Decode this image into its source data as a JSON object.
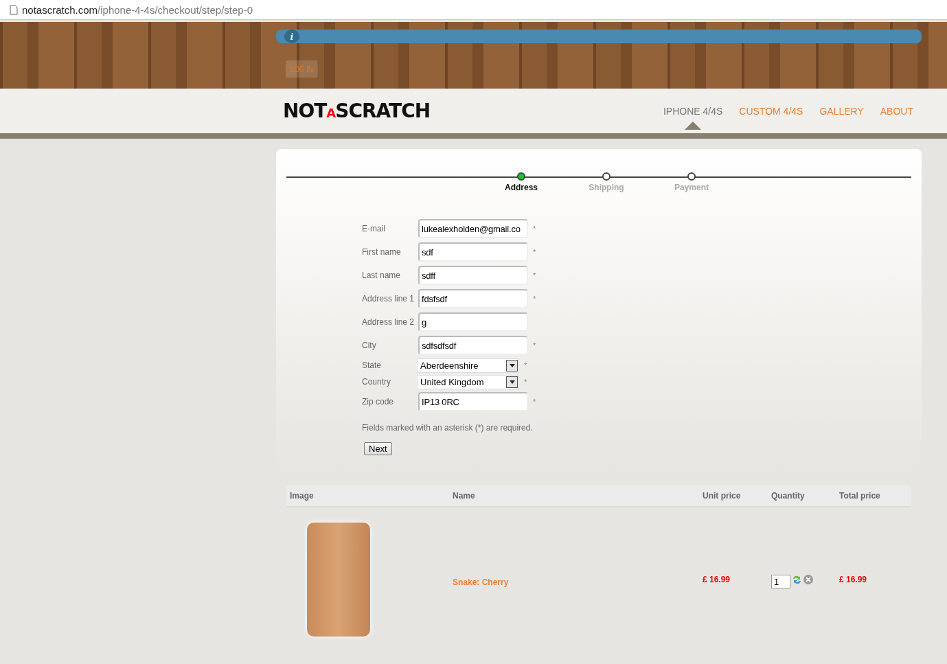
{
  "address_bar": {
    "host": "notascratch.com",
    "path": "/iphone-4-4s/checkout/step/step-0"
  },
  "header": {
    "login": "LOG IN",
    "info_icon": "i"
  },
  "logo": {
    "before": "NOT",
    "accent": "A",
    "after": "SCRATCH"
  },
  "nav": [
    {
      "label": "IPHONE 4/4S",
      "selected": true
    },
    {
      "label": "CUSTOM 4/4S",
      "selected": false
    },
    {
      "label": "GALLERY",
      "selected": false
    },
    {
      "label": "ABOUT",
      "selected": false
    }
  ],
  "steps": [
    {
      "label": "Address",
      "selected": true
    },
    {
      "label": "Shipping",
      "selected": false
    },
    {
      "label": "Payment",
      "selected": false
    }
  ],
  "form": {
    "fields": [
      {
        "kind": "text",
        "label": "E-mail",
        "value": "lukealexholden@gmail.co",
        "marker": "*"
      },
      {
        "kind": "text",
        "label": "First name",
        "value": "sdf",
        "marker": "*"
      },
      {
        "kind": "text",
        "label": "Last name",
        "value": "sdff",
        "marker": "*"
      },
      {
        "kind": "text",
        "label": "Address line 1",
        "value": "fdsfsdf",
        "marker": "*"
      },
      {
        "kind": "text",
        "label": "Address line 2",
        "value": "g"
      },
      {
        "kind": "text",
        "label": "City",
        "value": "sdfsdfsdf",
        "marker": "*"
      },
      {
        "kind": "select",
        "label": "State",
        "value": "Aberdeenshire",
        "marker": "*"
      },
      {
        "kind": "select",
        "label": "Country",
        "value": "United Kingdom",
        "marker": "*"
      },
      {
        "kind": "text",
        "label": "Zip code",
        "value": "IP13 0RC",
        "marker": "*"
      }
    ],
    "note": "Fields marked with an asterisk (*) are required.",
    "next": "Next"
  },
  "cart": {
    "columns": [
      "Image",
      "Name",
      "Unit price",
      "Quantity",
      "Total price"
    ],
    "rows": [
      {
        "name": "Snake: Cherry",
        "unit_price": "£ 16.99",
        "quantity": "1",
        "total_price": "£ 16.99"
      }
    ]
  }
}
